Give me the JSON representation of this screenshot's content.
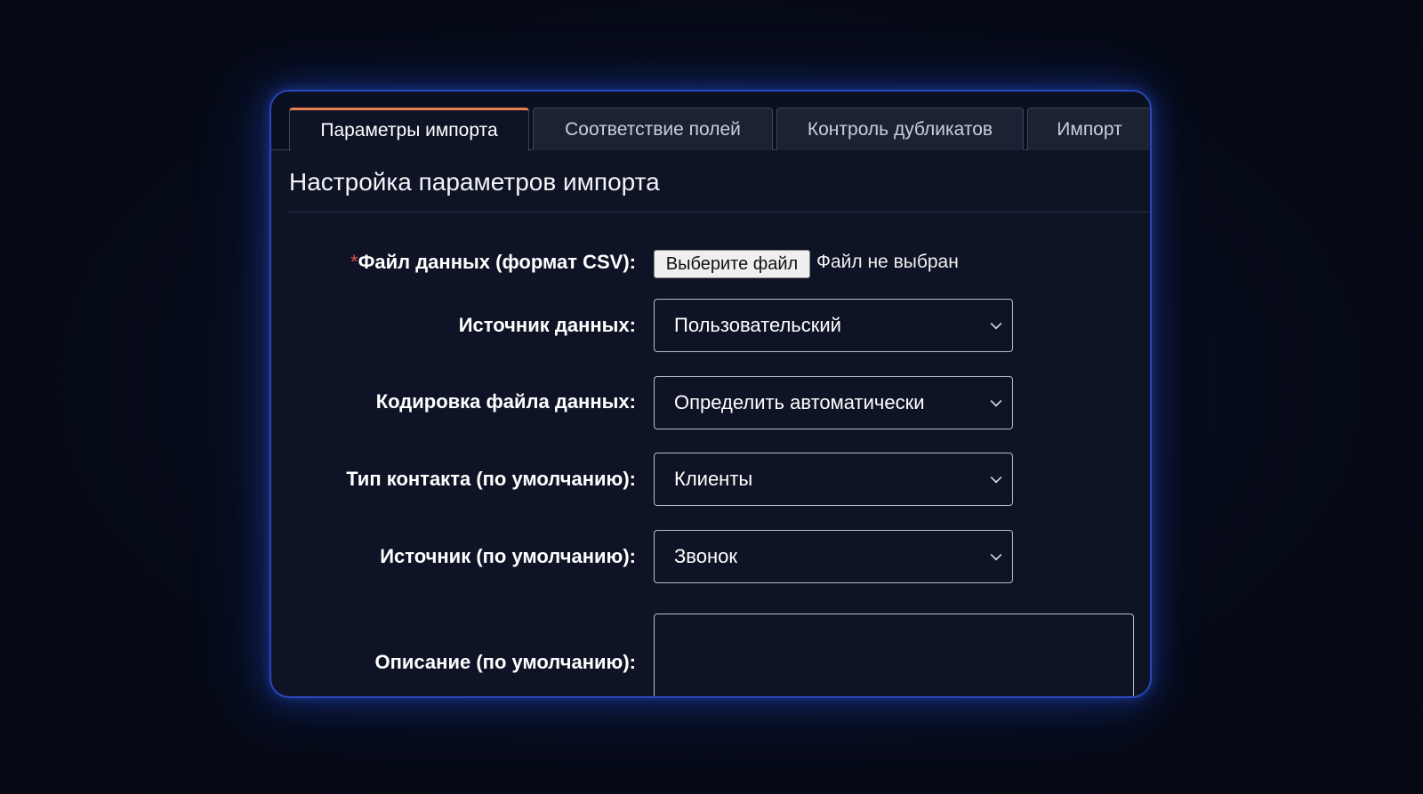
{
  "tabs": [
    {
      "label": "Параметры импорта",
      "active": true
    },
    {
      "label": "Соответствие полей",
      "active": false
    },
    {
      "label": "Контроль дубликатов",
      "active": false
    },
    {
      "label": "Импорт",
      "active": false
    }
  ],
  "section": {
    "title": "Настройка параметров импорта"
  },
  "form": {
    "file": {
      "required_mark": "*",
      "label": "Файл данных (формат CSV):",
      "button_label": "Выберите файл",
      "status": "Файл не выбран"
    },
    "data_source": {
      "label": "Источник данных:",
      "value": "Пользовательский"
    },
    "encoding": {
      "label": "Кодировка файла данных:",
      "value": "Определить автоматически"
    },
    "contact_type": {
      "label": "Тип контакта (по умолчанию):",
      "value": "Клиенты"
    },
    "source_default": {
      "label": "Источник (по умолчанию):",
      "value": "Звонок"
    },
    "description": {
      "label": "Описание (по умолчанию):",
      "value": ""
    }
  },
  "colors": {
    "active_tab_accent": "#e77f4e",
    "panel_border": "#2b46b8",
    "required": "#e24c4c"
  }
}
